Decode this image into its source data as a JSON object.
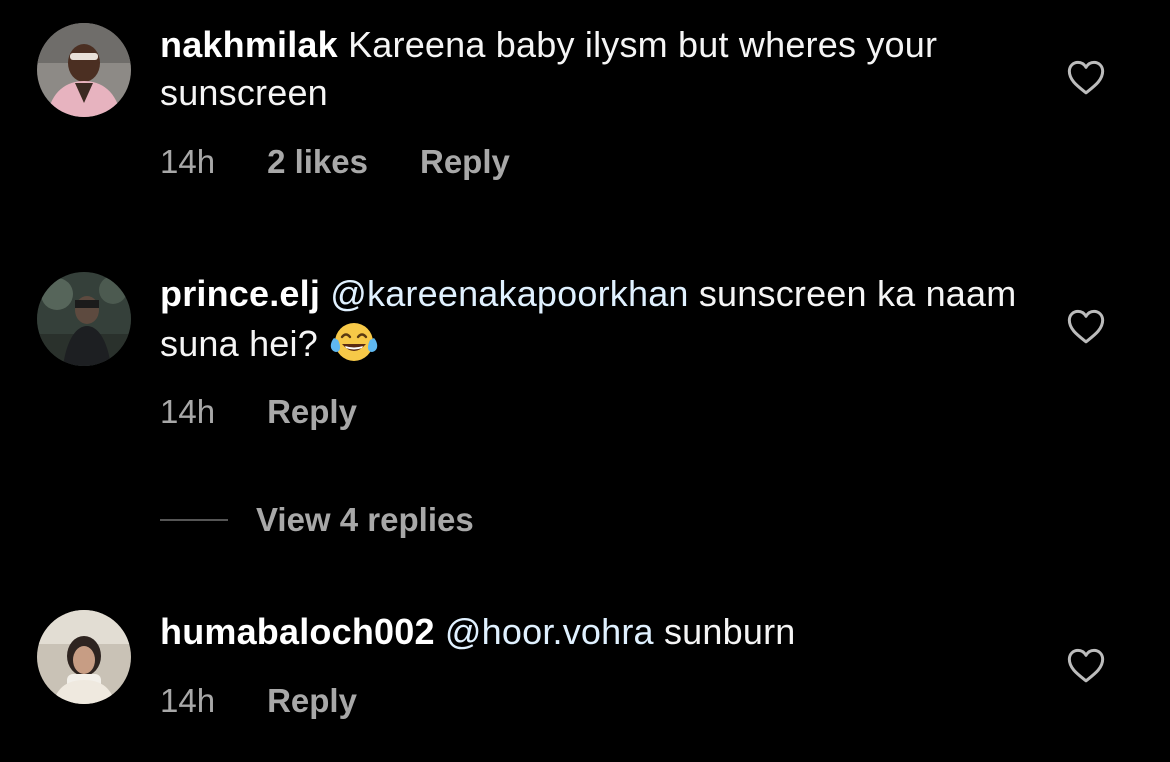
{
  "comments": [
    {
      "username": "nakhmilak",
      "mention": "",
      "text": "Kareena baby ilysm but wheres your sunscreen",
      "time": "14h",
      "likes": "2 likes",
      "reply": "Reply",
      "avatar": "woman-pink-jacket-avatar"
    },
    {
      "username": "prince.elj",
      "mention": "@kareenakapoorkhan",
      "text": "sunscreen ka naam suna hei?",
      "emoji": "😂",
      "time": "14h",
      "reply": "Reply",
      "avatar": "man-garden-avatar"
    },
    {
      "username": "humabaloch002",
      "mention": "@hoor.vohra",
      "text": "sunburn",
      "time": "14h",
      "reply": "Reply",
      "avatar": "woman-room-avatar"
    }
  ],
  "view_replies": "View 4 replies",
  "colors": {
    "background": "#000000",
    "text": "#f5f5f5",
    "secondary": "#a8a8a8",
    "mention": "#e0f1ff"
  },
  "icons": {
    "like": "heart-outline-icon",
    "emoji": "face-with-tears-of-joy"
  }
}
